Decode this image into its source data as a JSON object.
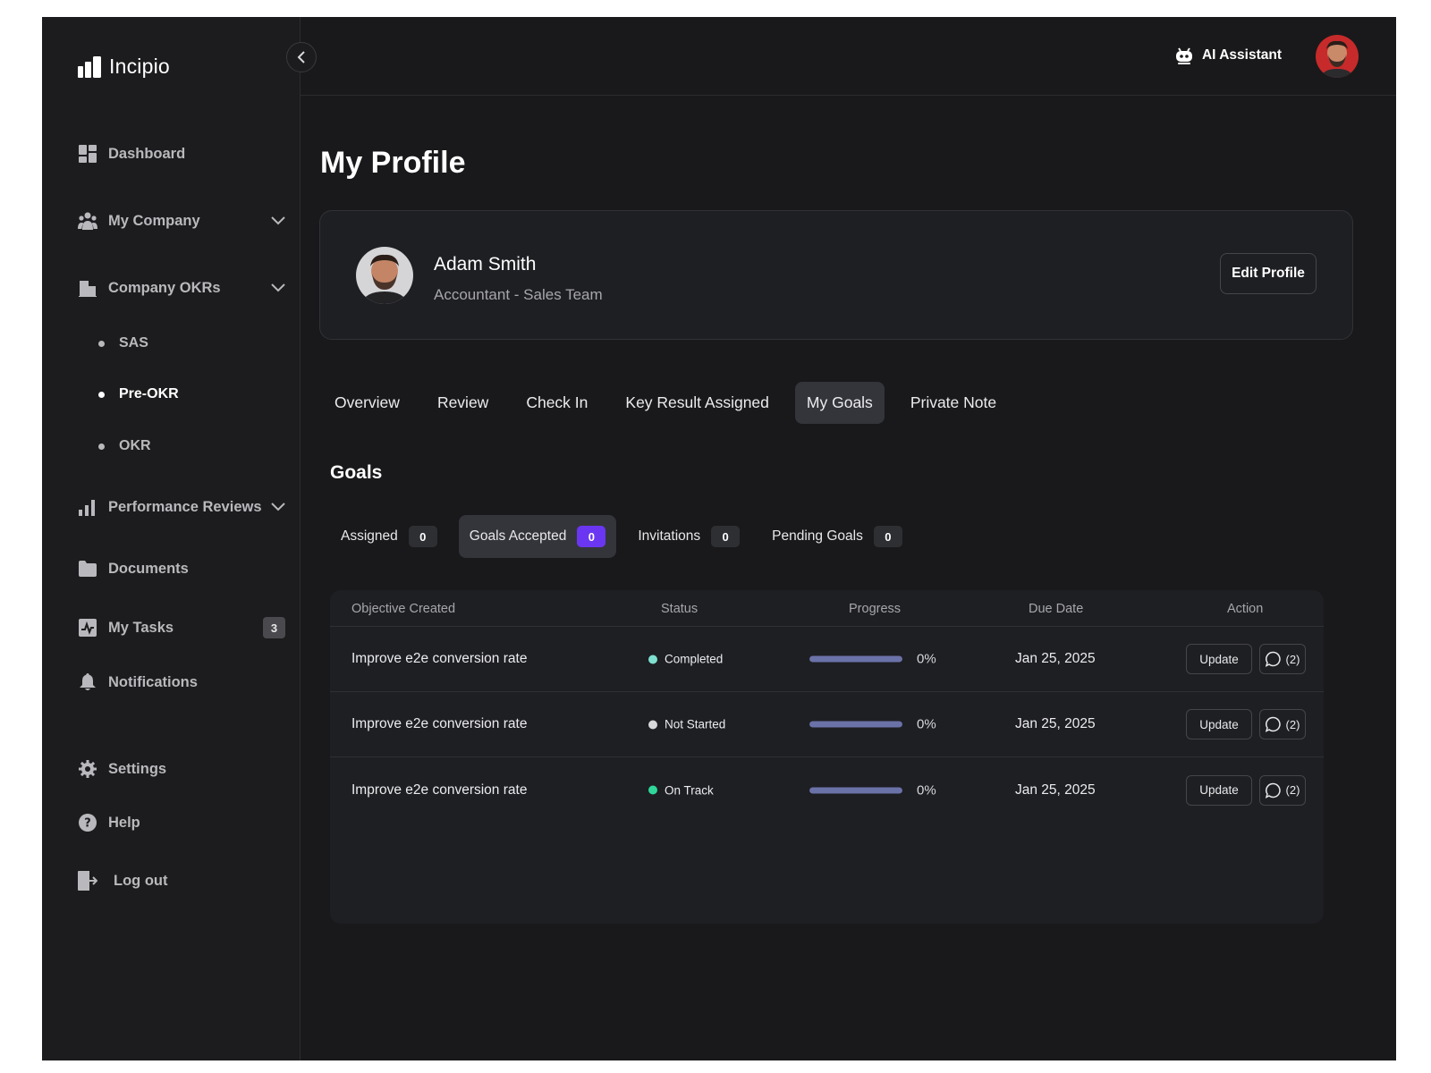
{
  "app": {
    "name": "Incipio"
  },
  "sidebar": {
    "items": [
      {
        "label": "Dashboard",
        "icon": "dashboard-icon"
      },
      {
        "label": "My Company",
        "icon": "people-icon",
        "expandable": true
      },
      {
        "label": "Company OKRs",
        "icon": "building-icon",
        "expandable": true
      },
      {
        "label": "Performance Reviews",
        "icon": "bar-chart-icon",
        "expandable": true
      },
      {
        "label": "Documents",
        "icon": "folder-icon"
      },
      {
        "label": "My Tasks",
        "icon": "tasks-icon",
        "badge": "3"
      },
      {
        "label": "Notifications",
        "icon": "bell-icon"
      },
      {
        "label": "Settings",
        "icon": "gear-icon"
      },
      {
        "label": "Help",
        "icon": "help-icon"
      },
      {
        "label": "Log out",
        "icon": "logout-icon"
      }
    ],
    "okr_sub_items": [
      {
        "label": "SAS",
        "active": false
      },
      {
        "label": "Pre-OKR",
        "active": true
      },
      {
        "label": "OKR",
        "active": false
      }
    ]
  },
  "topbar": {
    "ai_assistant_label": "AI Assistant"
  },
  "page": {
    "title": "My Profile"
  },
  "profile": {
    "name": "Adam Smith",
    "role": "Accountant - Sales Team",
    "edit_label": "Edit Profile"
  },
  "tabs": [
    {
      "label": "Overview",
      "active": false
    },
    {
      "label": "Review",
      "active": false
    },
    {
      "label": "Check In",
      "active": false
    },
    {
      "label": "Key Result Assigned",
      "active": false
    },
    {
      "label": "My Goals",
      "active": true
    },
    {
      "label": "Private Note",
      "active": false
    }
  ],
  "goals": {
    "title": "Goals",
    "subtabs": [
      {
        "label": "Assigned",
        "count": "0",
        "active": false
      },
      {
        "label": "Goals Accepted",
        "count": "0",
        "active": true
      },
      {
        "label": "Invitations",
        "count": "0",
        "active": false
      },
      {
        "label": "Pending Goals",
        "count": "0",
        "active": false
      }
    ],
    "columns": [
      "Objective Created",
      "Status",
      "Progress",
      "Due Date",
      "Action"
    ],
    "rows": [
      {
        "objective": "Improve e2e conversion rate",
        "status": "Completed",
        "status_color": "#7fe0d0",
        "progress": "0%",
        "progress_fraction": 1.0,
        "due": "Jan 25, 2025",
        "update_label": "Update",
        "comments": "(2)"
      },
      {
        "objective": "Improve e2e conversion rate",
        "status": "Not Started",
        "status_color": "#d8d8db",
        "progress": "0%",
        "progress_fraction": 1.0,
        "due": "Jan 25, 2025",
        "update_label": "Update",
        "comments": "(2)"
      },
      {
        "objective": "Improve e2e conversion rate",
        "status": "On Track",
        "status_color": "#2fd79a",
        "progress": "0%",
        "progress_fraction": 1.0,
        "due": "Jan 25, 2025",
        "update_label": "Update",
        "comments": "(2)"
      }
    ]
  },
  "colors": {
    "accent": "#6b36f2",
    "progress_fill": "#6b72a8",
    "background": "#19191b",
    "sidebar": "#1c1c1e"
  }
}
